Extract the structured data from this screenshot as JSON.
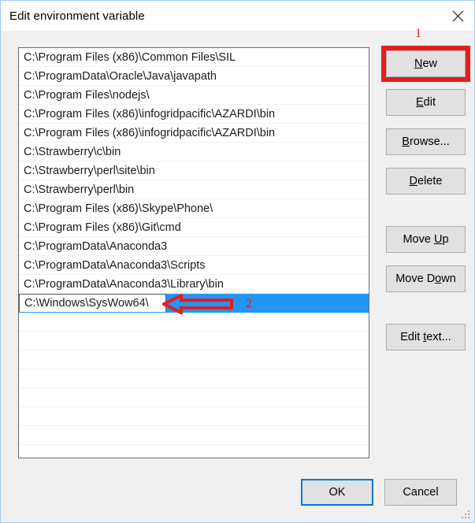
{
  "window": {
    "title": "Edit environment variable",
    "close_icon": "close-icon"
  },
  "list": {
    "items": [
      "C:\\Program Files (x86)\\Common Files\\SIL",
      "C:\\ProgramData\\Oracle\\Java\\javapath",
      "C:\\Program Files\\nodejs\\",
      "C:\\Program Files (x86)\\infogridpacific\\AZARDI\\bin",
      "C:\\Program Files (x86)\\infogridpacific\\AZARDI\\bin",
      "C:\\Strawberry\\c\\bin",
      "C:\\Strawberry\\perl\\site\\bin",
      "C:\\Strawberry\\perl\\bin",
      "C:\\Program Files (x86)\\Skype\\Phone\\",
      "C:\\Program Files (x86)\\Git\\cmd",
      "C:\\ProgramData\\Anaconda3",
      "C:\\ProgramData\\Anaconda3\\Scripts",
      "C:\\ProgramData\\Anaconda3\\Library\\bin"
    ],
    "selected_index": 13,
    "editing_value": "C:\\Windows\\SysWow64\\",
    "empty_row_count": 8,
    "selection_color": "#2196f3"
  },
  "side_buttons": {
    "new": {
      "pre": "",
      "accel": "N",
      "post": "ew"
    },
    "edit": {
      "pre": "",
      "accel": "E",
      "post": "dit"
    },
    "browse": {
      "pre": "",
      "accel": "B",
      "post": "rowse..."
    },
    "delete": {
      "pre": "",
      "accel": "D",
      "post": "elete"
    },
    "move_up": {
      "pre": "Move ",
      "accel": "U",
      "post": "p"
    },
    "move_down": {
      "pre": "Move D",
      "accel": "o",
      "post": "wn"
    },
    "edit_text": {
      "pre": "Edit ",
      "accel": "t",
      "post": "ext..."
    }
  },
  "footer": {
    "ok": "OK",
    "cancel": "Cancel"
  },
  "annotations": {
    "color": "#e81c1c",
    "marker_1": "1",
    "marker_2": "2",
    "arrow_icon": "left-arrow-annotation-icon",
    "box_target": "New"
  }
}
